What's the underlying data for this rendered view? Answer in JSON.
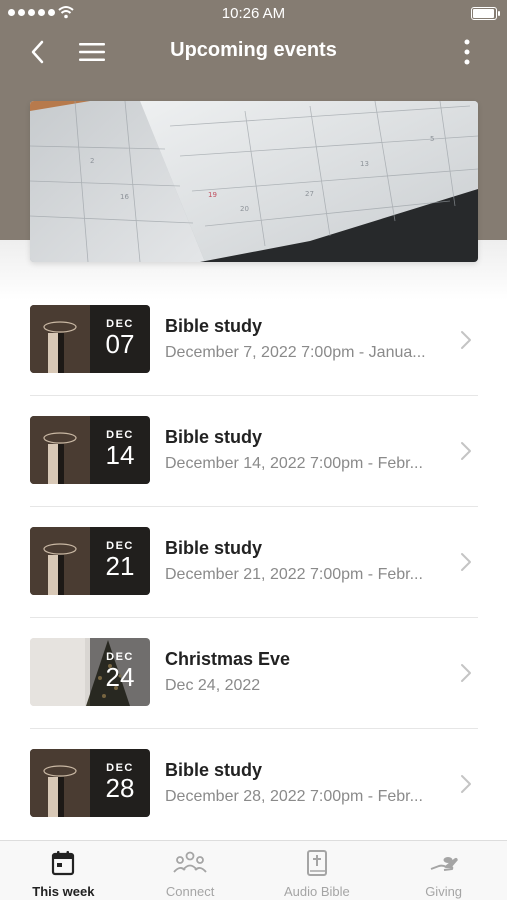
{
  "status_bar": {
    "time": "10:26 AM"
  },
  "nav": {
    "title": "Upcoming events"
  },
  "colors": {
    "header": "#857c72",
    "active_tab": "#222222",
    "inactive_tab": "#a5a5a5"
  },
  "events": [
    {
      "month": "DEC",
      "day": "07",
      "title": "Bible study",
      "subtitle": "December 7, 2022 7:00pm - Janua..."
    },
    {
      "month": "DEC",
      "day": "14",
      "title": "Bible study",
      "subtitle": "December 14, 2022 7:00pm - Febr..."
    },
    {
      "month": "DEC",
      "day": "21",
      "title": "Bible study",
      "subtitle": "December 21, 2022 7:00pm - Febr..."
    },
    {
      "month": "DEC",
      "day": "24",
      "title": "Christmas Eve",
      "subtitle": "Dec 24, 2022"
    },
    {
      "month": "DEC",
      "day": "28",
      "title": "Bible study",
      "subtitle": "December 28, 2022 7:00pm - Febr..."
    }
  ],
  "tabs": [
    {
      "label": "This week",
      "icon": "calendar-icon",
      "active": true
    },
    {
      "label": "Connect",
      "icon": "people-icon",
      "active": false
    },
    {
      "label": "Audio Bible",
      "icon": "bible-icon",
      "active": false
    },
    {
      "label": "Giving",
      "icon": "giving-hand-icon",
      "active": false
    }
  ]
}
